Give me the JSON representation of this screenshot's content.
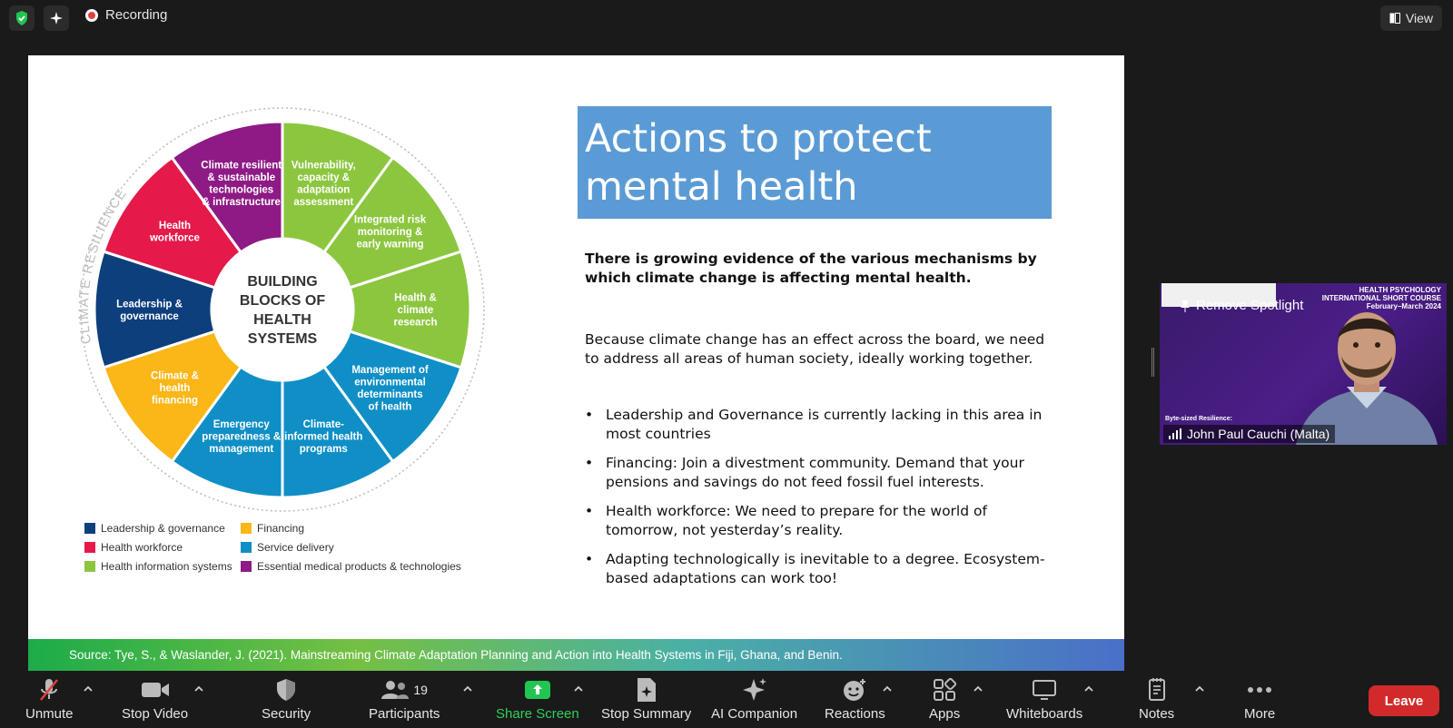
{
  "topbar": {
    "recording_label": "Recording",
    "view_label": "View"
  },
  "slide": {
    "title": "Actions to protect mental health",
    "lead": "There is growing evidence of the various mechanisms by which climate change is affecting mental health.",
    "paragraph": "Because climate change has an effect across the board, we need to address all areas of human society, ideally working together.",
    "bullets": [
      "Leadership and Governance is currently lacking in this area in most countries",
      "Financing: Join a divestment community. Demand that your pensions and savings do not feed fossil fuel interests.",
      "Health workforce: We need to prepare for the world of tomorrow, not yesterday’s reality.",
      "Adapting technologically is inevitable to a degree. Ecosystem-based adaptations can work too!"
    ],
    "source": "Source: Tye, S., & Waslander, J. (2021). Mainstreaming Climate Adaptation Planning and Action into Health Systems in Fiji, Ghana, and Benin.",
    "wheel": {
      "center": [
        "BUILDING",
        "BLOCKS OF",
        "HEALTH",
        "SYSTEMS"
      ],
      "arc_label": "CLIMATE RESILIENCE",
      "segments": [
        {
          "lines": [
            "Leadership &",
            "governance"
          ],
          "color": "#0d3f7c"
        },
        {
          "lines": [
            "Health",
            "workforce"
          ],
          "color": "#e5194a"
        },
        {
          "lines": [
            "Climate resilient",
            "& sustainable",
            "technologies",
            "& infrastructure"
          ],
          "color": "#8e1a85"
        },
        {
          "lines": [
            "Vulnerability,",
            "capacity &",
            "adaptation",
            "assessment"
          ],
          "color": "#8cc63f"
        },
        {
          "lines": [
            "Integrated risk",
            "monitoring &",
            "early warning"
          ],
          "color": "#8cc63f"
        },
        {
          "lines": [
            "Health &",
            "climate",
            "research"
          ],
          "color": "#8cc63f"
        },
        {
          "lines": [
            "Management of",
            "environmental",
            "determinants",
            "of health"
          ],
          "color": "#0f8fc6"
        },
        {
          "lines": [
            "Climate-",
            "informed health",
            "programs"
          ],
          "color": "#0f8fc6"
        },
        {
          "lines": [
            "Emergency",
            "preparedness &",
            "management"
          ],
          "color": "#0f8fc6"
        },
        {
          "lines": [
            "Climate &",
            "health",
            "financing"
          ],
          "color": "#fbb617"
        }
      ]
    },
    "legend": [
      {
        "label": "Leadership & governance",
        "color": "#0d3f7c"
      },
      {
        "label": "Financing",
        "color": "#fbb617"
      },
      {
        "label": "Health workforce",
        "color": "#e5194a"
      },
      {
        "label": "Service delivery",
        "color": "#0f8fc6"
      },
      {
        "label": "Health information systems",
        "color": "#8cc63f"
      },
      {
        "label": "Essential medical products & technologies",
        "color": "#8e1a85"
      }
    ]
  },
  "video": {
    "spotlight_label": "Remove Spotlight",
    "participant_name": "John Paul Cauchi (Malta)",
    "course_lines": [
      "HEALTH PSYCHOLOGY",
      "INTERNATIONAL SHORT COURSE",
      "February–March 2024"
    ],
    "byte_text": "Byte-sized Resilience:"
  },
  "toolbar": {
    "unmute": "Unmute",
    "stop_video": "Stop Video",
    "security": "Security",
    "participants": "Participants",
    "participants_count": "19",
    "share_screen": "Share Screen",
    "stop_summary": "Stop Summary",
    "ai_companion": "AI Companion",
    "reactions": "Reactions",
    "apps": "Apps",
    "whiteboards": "Whiteboards",
    "notes": "Notes",
    "more": "More",
    "leave": "Leave"
  }
}
